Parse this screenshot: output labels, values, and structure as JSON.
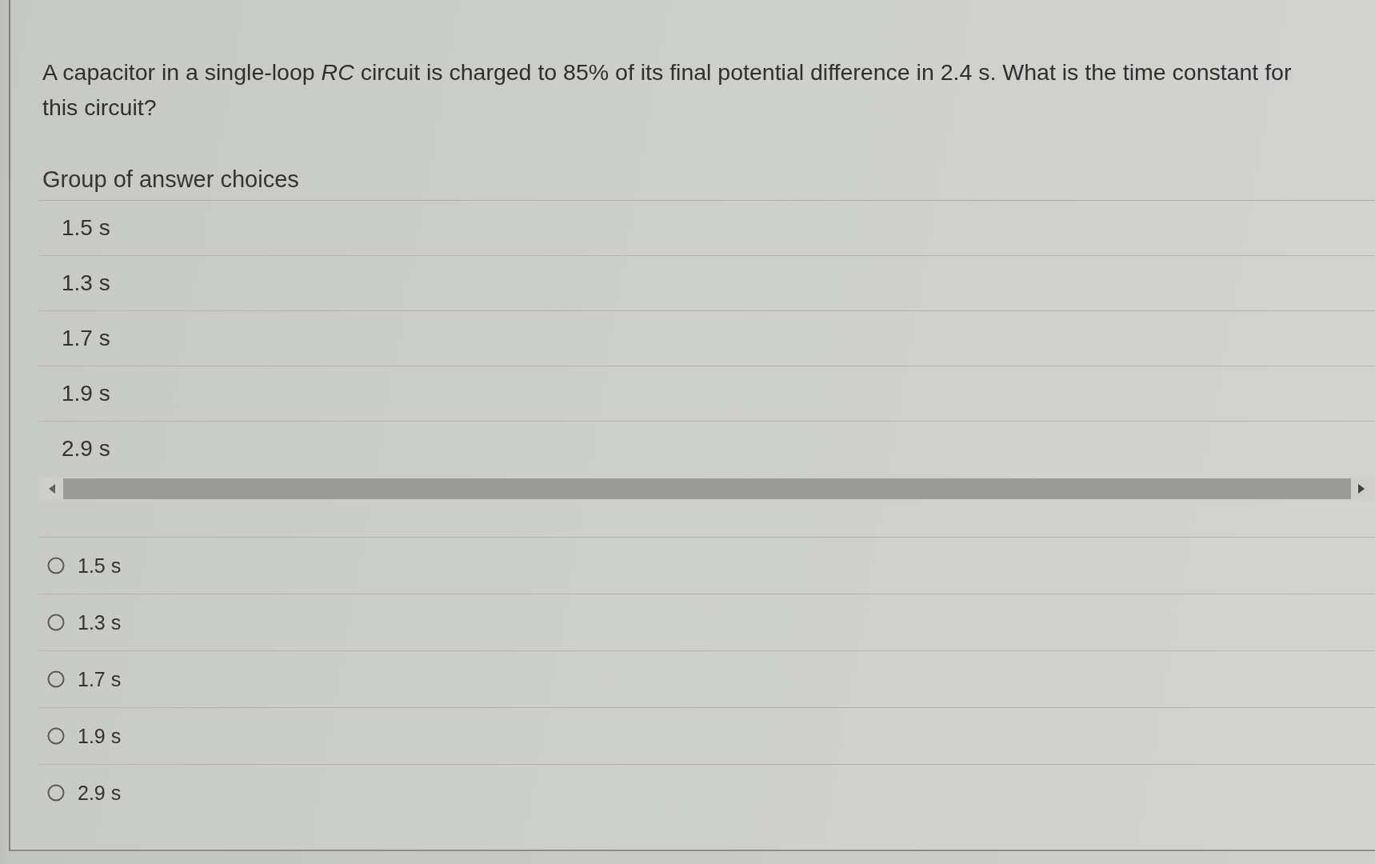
{
  "question": {
    "text": "A capacitor in a single-loop *RC* circuit is charged to 85% of its final potential difference in 2.4 s. What is the time constant for this circuit?"
  },
  "answer_group": {
    "heading": "Group of answer choices",
    "choices": [
      "1.5 s",
      "1.3 s",
      "1.7 s",
      "1.9 s",
      "2.9 s"
    ]
  },
  "answer_options": [
    {
      "label": "1.5 s",
      "selected": false
    },
    {
      "label": "1.3 s",
      "selected": false
    },
    {
      "label": "1.7 s",
      "selected": false
    },
    {
      "label": "1.9 s",
      "selected": false
    },
    {
      "label": "2.9 s",
      "selected": false
    }
  ]
}
